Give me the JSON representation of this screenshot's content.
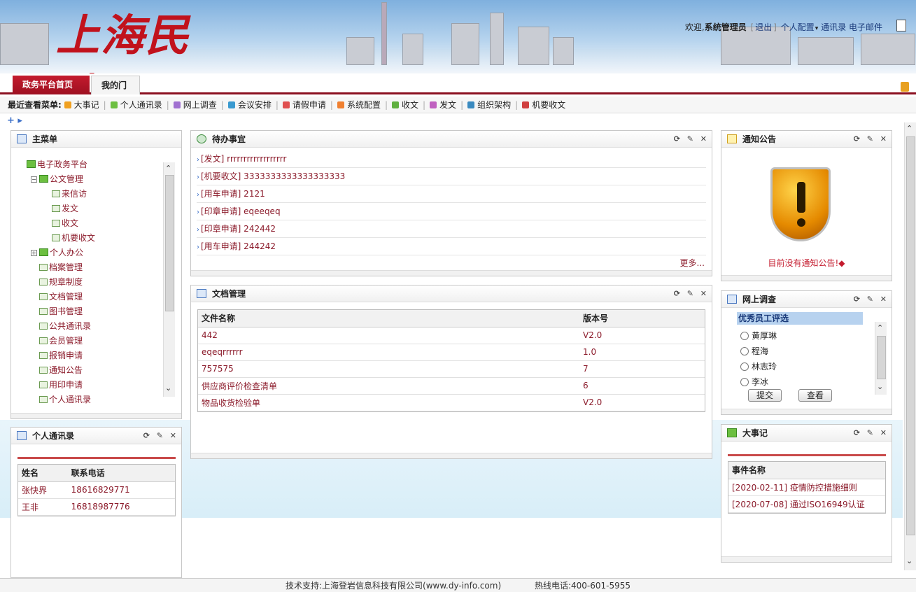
{
  "header": {
    "logo_text": "上海民建",
    "welcome": "欢迎,",
    "username": "系统管理员",
    "logout": "退出",
    "logout_bracket_open": "[",
    "logout_bracket_close": "]",
    "links": [
      "个人配置",
      "通讯录",
      "电子邮件"
    ]
  },
  "tabs": [
    {
      "label": "政务平台首页",
      "active": true,
      "chevron": "⌄"
    },
    {
      "label": "我的门户",
      "active": false
    }
  ],
  "recent_menu": {
    "label": "最近查看菜单:",
    "items": [
      {
        "label": "大事记",
        "color": "#f0a020"
      },
      {
        "label": "个人通讯录",
        "color": "#6cbf40"
      },
      {
        "label": "网上调查",
        "color": "#a070d0"
      },
      {
        "label": "会议安排",
        "color": "#3a9ad0"
      },
      {
        "label": "请假申请",
        "color": "#e05050"
      },
      {
        "label": "系统配置",
        "color": "#f08030"
      },
      {
        "label": "收文",
        "color": "#60b040"
      },
      {
        "label": "发文",
        "color": "#c060c0"
      },
      {
        "label": "组织架构",
        "color": "#3a8ac0"
      },
      {
        "label": "机要收文",
        "color": "#d04040"
      }
    ]
  },
  "main_menu": {
    "title": "主菜单",
    "tree": [
      {
        "label": "电子政务平台",
        "level": 0,
        "type": "root"
      },
      {
        "label": "公文管理",
        "level": 1,
        "type": "folder",
        "toggle": "⊟"
      },
      {
        "label": "来信访",
        "level": 2,
        "type": "doc"
      },
      {
        "label": "发文",
        "level": 2,
        "type": "doc"
      },
      {
        "label": "收文",
        "level": 2,
        "type": "doc"
      },
      {
        "label": "机要收文",
        "level": 2,
        "type": "doc"
      },
      {
        "label": "个人办公",
        "level": 1,
        "type": "folder",
        "toggle": "⊞"
      },
      {
        "label": "档案管理",
        "level": 1,
        "type": "doc"
      },
      {
        "label": "规章制度",
        "level": 1,
        "type": "doc"
      },
      {
        "label": "文档管理",
        "level": 1,
        "type": "doc"
      },
      {
        "label": "图书管理",
        "level": 1,
        "type": "doc"
      },
      {
        "label": "公共通讯录",
        "level": 1,
        "type": "doc"
      },
      {
        "label": "会员管理",
        "level": 1,
        "type": "doc"
      },
      {
        "label": "报销申请",
        "level": 1,
        "type": "doc"
      },
      {
        "label": "通知公告",
        "level": 1,
        "type": "doc"
      },
      {
        "label": "用印申请",
        "level": 1,
        "type": "doc"
      },
      {
        "label": "个人通讯录",
        "level": 1,
        "type": "doc"
      }
    ]
  },
  "todo": {
    "title": "待办事宜",
    "items": [
      "[发文] rrrrrrrrrrrrrrrrrr",
      "[机要收文] 3333333333333333333",
      "[用车申请] 2121",
      "[印章申请] eqeeqeq",
      "[印章申请] 242442",
      "[用车申请] 244242"
    ],
    "more": "更多..."
  },
  "docs": {
    "title": "文档管理",
    "headers": [
      "文件名称",
      "版本号"
    ],
    "rows": [
      [
        "442",
        "V2.0"
      ],
      [
        "eqeqrrrrrr",
        "1.0"
      ],
      [
        "757575",
        "7"
      ],
      [
        "供应商评价检查清单",
        "6"
      ],
      [
        "物品收货检验单",
        "V2.0"
      ]
    ]
  },
  "contacts": {
    "title": "个人通讯录",
    "headers": [
      "姓名",
      "联系电话"
    ],
    "rows": [
      [
        "张快界",
        "18616829771"
      ],
      [
        "王非",
        "16818987776"
      ]
    ]
  },
  "notice": {
    "title": "通知公告",
    "empty_text": "目前没有通知公告!◆"
  },
  "survey": {
    "title": "网上调查",
    "question": "优秀员工评选",
    "options": [
      "黄厚琳",
      "程海",
      "林志玲",
      "李冰"
    ],
    "submit": "提交",
    "view": "查看"
  },
  "events": {
    "title": "大事记",
    "header": "事件名称",
    "rows": [
      "[2020-02-11] 疫情防控措施细则",
      "[2020-07-08] 通过ISO16949认证"
    ]
  },
  "panel_tools": "⟳ ✎ ✕",
  "footer": {
    "support": "技术支持:上海登岩信息科技有限公司(www.dy-info.com)",
    "hotline": "热线电话:400-601-5955"
  }
}
